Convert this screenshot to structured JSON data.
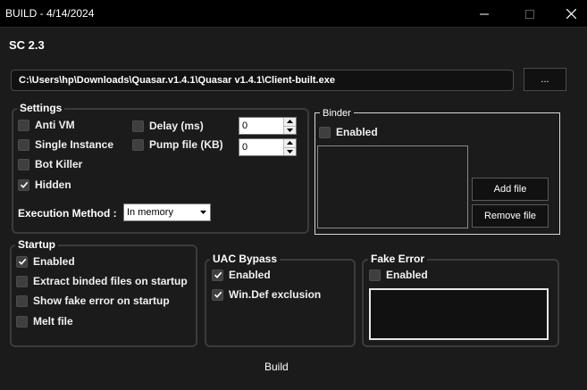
{
  "window": {
    "title": "BUILD - 4/14/2024",
    "minimize_icon": "minimize-icon",
    "maximize_icon": "maximize-icon",
    "close_icon": "close-icon"
  },
  "app_label": "SC 2.3",
  "output_path": {
    "value": "C:\\Users\\hp\\Downloads\\Quasar.v1.4.1\\Quasar v1.4.1\\Client-built.exe",
    "browse_label": "..."
  },
  "settings": {
    "title": "Settings",
    "anti_vm": {
      "label": "Anti VM",
      "checked": false
    },
    "single_instance": {
      "label": "Single Instance",
      "checked": false
    },
    "bot_killer": {
      "label": "Bot Killer",
      "checked": false
    },
    "hidden": {
      "label": "Hidden",
      "checked": true
    },
    "delay": {
      "label": "Delay (ms)",
      "checked": false,
      "value": "0"
    },
    "pump_file": {
      "label": "Pump file (KB)",
      "checked": false,
      "value": "0"
    },
    "execution_method": {
      "label": "Execution Method :",
      "value": "In memory"
    }
  },
  "binder": {
    "title": "Binder",
    "enabled": {
      "label": "Enabled",
      "checked": false
    },
    "add_file_label": "Add file",
    "remove_file_label": "Remove file"
  },
  "startup": {
    "title": "Startup",
    "enabled": {
      "label": "Enabled",
      "checked": true
    },
    "extract_binded": {
      "label": "Extract binded files on startup",
      "checked": false
    },
    "show_fake_error": {
      "label": "Show fake error on startup",
      "checked": false
    },
    "melt_file": {
      "label": "Melt file",
      "checked": false
    }
  },
  "uac_bypass": {
    "title": "UAC Bypass",
    "enabled": {
      "label": "Enabled",
      "checked": true
    },
    "windef_exclusion": {
      "label": "Win.Def exclusion",
      "checked": true
    }
  },
  "fake_error": {
    "title": "Fake Error",
    "enabled": {
      "label": "Enabled",
      "checked": false
    }
  },
  "build_label": "Build",
  "colors": {
    "background": "#1b1b1b",
    "titlebar": "#000000",
    "group_border": "#3b3b3b",
    "text": "#ffffff"
  }
}
